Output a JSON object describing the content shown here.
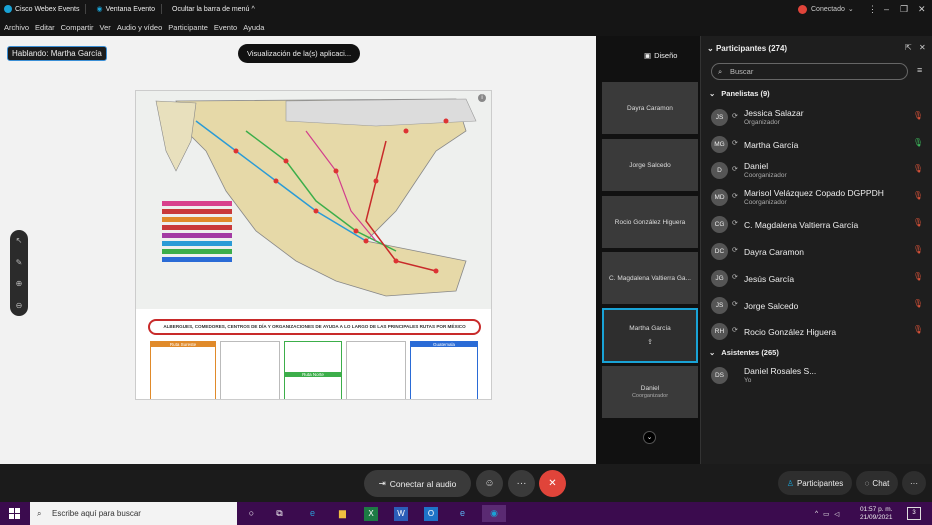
{
  "titlebar": {
    "app_title": "Cisco Webex Events",
    "window_label": "Ventana Evento",
    "hide_menu": "Ocultar la barra de menú",
    "connection": "Conectado"
  },
  "menu": [
    "Archivo",
    "Editar",
    "Compartir",
    "Ver",
    "Audio y vídeo",
    "Participante",
    "Evento",
    "Ayuda"
  ],
  "stage": {
    "speaking": "Hablando: Martha García",
    "view_button": "Visualización de la(s) aplicaci...",
    "slide_banner": "ALBERGUES, COMEDORES, CENTROS DE DÍA Y ORGANIZACIONES DE AYUDA A LO LARGO DE LAS PRINCIPALES RUTAS POR MÉXICO",
    "slide_columns": [
      "Ruta Sureste",
      "Ruta Norte",
      "Guatemala"
    ]
  },
  "strip": {
    "layout": "Diseño",
    "tiles": [
      {
        "name": "Dayra Caramon",
        "sub": ""
      },
      {
        "name": "Jorge Salcedo",
        "sub": ""
      },
      {
        "name": "Rocio González Higuera",
        "sub": ""
      },
      {
        "name": "C. Magdalena Valtierra Ga...",
        "sub": ""
      },
      {
        "name": "Martha García",
        "sub": ""
      },
      {
        "name": "Daniel",
        "sub": "Coorganizador"
      }
    ]
  },
  "panel": {
    "title": "Participantes (274)",
    "search_placeholder": "Buscar",
    "panelists_header": "Panelistas (9)",
    "attendees_header": "Asistentes (265)"
  },
  "panelists": [
    {
      "initials": "JS",
      "name": "Jessica Salazar",
      "role": "Organizador",
      "mic": "muted"
    },
    {
      "initials": "MG",
      "name": "Martha García",
      "role": "",
      "mic": "active"
    },
    {
      "initials": "D",
      "name": "Daniel",
      "role": "Coorganizador",
      "mic": "muted"
    },
    {
      "initials": "MD",
      "name": "Marisol Velázquez Copado DGPPDH",
      "role": "Coorganizador",
      "mic": "muted"
    },
    {
      "initials": "CG",
      "name": "C. Magdalena Valtierra García",
      "role": "",
      "mic": "muted"
    },
    {
      "initials": "DC",
      "name": "Dayra Caramon",
      "role": "",
      "mic": "muted"
    },
    {
      "initials": "JG",
      "name": "Jesús García",
      "role": "",
      "mic": "muted"
    },
    {
      "initials": "JS",
      "name": "Jorge Salcedo",
      "role": "",
      "mic": "muted"
    },
    {
      "initials": "RH",
      "name": "Rocio González Higuera",
      "role": "",
      "mic": "muted"
    }
  ],
  "attendees": [
    {
      "initials": "DS",
      "name": "Daniel Rosales S...",
      "role": "Yo"
    }
  ],
  "controls": {
    "audio": "Conectar al audio",
    "participants_tab": "Participantes",
    "chat_tab": "Chat"
  },
  "taskbar": {
    "search": "Escribe aquí para buscar",
    "time": "01:57 p. m.",
    "date": "21/09/2021",
    "notifications": "3"
  },
  "colors": {
    "accent": "#19a3d6",
    "end_call": "#e0443a",
    "mic_active": "#3fbf5f",
    "mic_muted": "#e2553a",
    "taskbar": "#3b0b4e"
  }
}
